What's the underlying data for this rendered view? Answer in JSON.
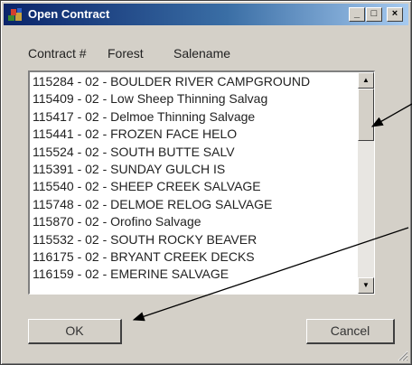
{
  "window": {
    "title": "Open Contract",
    "minimize_label": "_",
    "maximize_label": "□",
    "close_label": "×"
  },
  "list_header": {
    "contract_col": "Contract #",
    "forest_col": "Forest",
    "salename_col": "Salename"
  },
  "contracts": [
    "115284  -  02  -  BOULDER RIVER CAMPGROUND",
    "115409  -  02  -  Low Sheep Thinning Salvag",
    "115417  -  02  -  Delmoe Thinning Salvage",
    "115441  -  02  -  FROZEN FACE HELO",
    "115524  -  02  -  SOUTH BUTTE SALV",
    "115391  -  02  -  SUNDAY GULCH IS",
    "115540  -  02  -  SHEEP CREEK SALVAGE",
    "115748  -  02  -  DELMOE RELOG SALVAGE",
    "115870  -  02  -  Orofino Salvage",
    "115532  -  02  -  SOUTH ROCKY BEAVER",
    "116175  -  02  -  BRYANT CREEK DECKS",
    "116159  -  02  -  EMERINE SALVAGE"
  ],
  "buttons": {
    "ok_label": "OK",
    "cancel_label": "Cancel"
  },
  "icons": {
    "app": "contract-app-icon",
    "scroll_up": "scroll-up-arrow-icon",
    "scroll_down": "scroll-down-arrow-icon",
    "resize": "resize-grip-icon"
  },
  "colors": {
    "titlebar_start": "#0a246a",
    "titlebar_end": "#a6caf0",
    "face": "#d4d0c8",
    "annotation_arrow": "#000000"
  }
}
